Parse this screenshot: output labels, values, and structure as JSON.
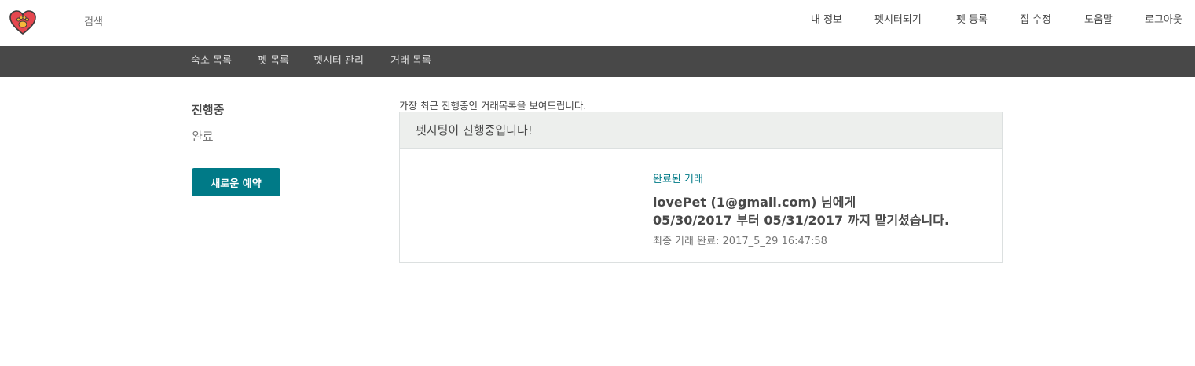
{
  "header": {
    "logo_icon": "heart-paw-icon",
    "search_label": "검색",
    "nav": {
      "my_info": "내 정보",
      "become_sitter": "펫시터되기",
      "register_pet": "펫 등록",
      "edit_home": "집 수정",
      "help": "도움말",
      "logout": "로그아웃"
    }
  },
  "subnav": {
    "lodging_list": "숙소 목록",
    "pet_list": "펫 목록",
    "sitter_manage": "펫시터 관리",
    "transaction_list": "거래 목록"
  },
  "sidebar": {
    "in_progress": "진행중",
    "completed": "완료",
    "new_reservation": "새로운 예약"
  },
  "main": {
    "intro": "가장 최근 진행중인 거래목록을 보여드립니다.",
    "panel_title": "펫시팅이 진행중입니다!",
    "completed_link": "완료된 거래",
    "message_line1": "lovePet (1@gmail.com) 님에게",
    "message_line2": "05/30/2017 부터 05/31/2017 까지 맡기셨습니다.",
    "final_time": "최종 거래 완료: 2017_5_29 16:47:58"
  },
  "colors": {
    "accent": "#007a87",
    "subnav_bg": "#484848",
    "logo_heart": "#e5474f"
  }
}
